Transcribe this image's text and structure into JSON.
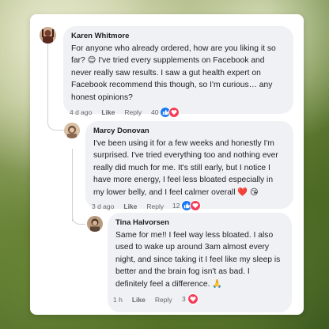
{
  "comments": [
    {
      "author": "Karen Whitmore",
      "text": "For anyone who already ordered, how are you liking it so far? 😊  I've tried every supplements on Facebook and never really saw results. I saw a gut health expert on Facebook recommend this though, so I'm curious… any honest opinions?",
      "time": "4 d ago",
      "like_label": "Like",
      "reply_label": "Reply",
      "reaction_count": "40",
      "reactions": [
        "like",
        "love"
      ]
    },
    {
      "author": "Marcy Donovan",
      "text": "I've been using it for a few weeks and honestly I'm surprised. I've tried everything too and nothing ever really did much for me. It's still early, but I notice I have more energy, I feel less bloated especially in my lower belly, and I feel calmer overall ❤️ 😘",
      "time": "3 d ago",
      "like_label": "Like",
      "reply_label": "Reply",
      "reaction_count": "12",
      "reactions": [
        "like",
        "love"
      ]
    },
    {
      "author": "Tina Halvorsen",
      "text": "Same for me!! I feel way less bloated. I also used to wake up around 3am almost every night, and since taking it I feel like my sleep is better and the brain fog isn't as bad. I definitely feel a difference. 🙏",
      "time": "1 h",
      "like_label": "Like",
      "reply_label": "Reply",
      "reaction_count": "3",
      "reactions": [
        "love"
      ]
    }
  ],
  "colors": {
    "like_blue": "#1877f2",
    "love_red": "#f33e58",
    "bubble_bg": "#eff1f4",
    "meta_gray": "#65676b"
  }
}
